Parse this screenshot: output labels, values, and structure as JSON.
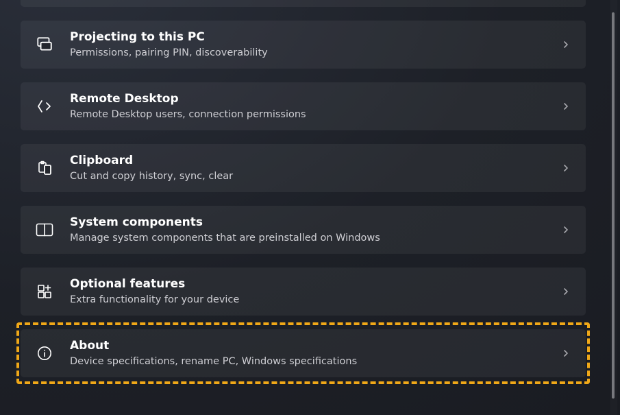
{
  "items": [
    {
      "id": "projecting",
      "title": "Projecting to this PC",
      "sub": "Permissions, pairing PIN, discoverability"
    },
    {
      "id": "remote-desktop",
      "title": "Remote Desktop",
      "sub": "Remote Desktop users, connection permissions"
    },
    {
      "id": "clipboard",
      "title": "Clipboard",
      "sub": "Cut and copy history, sync, clear"
    },
    {
      "id": "system-components",
      "title": "System components",
      "sub": "Manage system components that are preinstalled on Windows"
    },
    {
      "id": "optional-features",
      "title": "Optional features",
      "sub": "Extra functionality for your device"
    },
    {
      "id": "about",
      "title": "About",
      "sub": "Device specifications, rename PC, Windows specifications"
    }
  ],
  "highlighted_id": "about",
  "scrollbar": {
    "thumb_top_pct": 3,
    "thumb_height_pct": 93
  }
}
